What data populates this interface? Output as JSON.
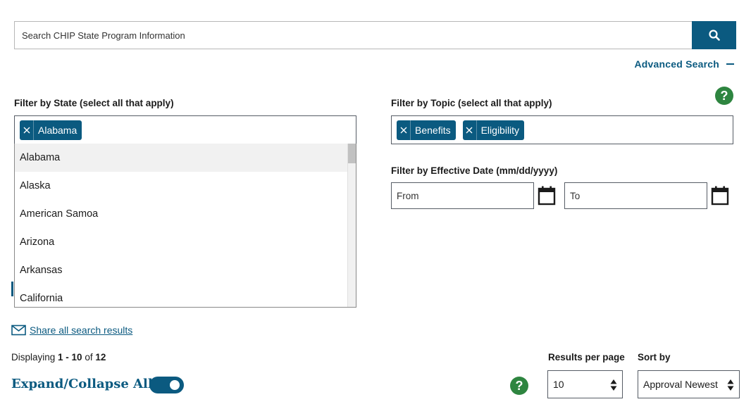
{
  "search": {
    "placeholder": "Search CHIP State Program Information"
  },
  "advanced_search": {
    "label": "Advanced Search"
  },
  "filter_state": {
    "label": "Filter by State (select all that apply)",
    "selected": [
      "Alabama"
    ],
    "options": [
      "Alabama",
      "Alaska",
      "American Samoa",
      "Arizona",
      "Arkansas",
      "California"
    ]
  },
  "filter_topic": {
    "label": "Filter by Topic (select all that apply)",
    "selected": [
      "Benefits",
      "Eligibility"
    ]
  },
  "filter_date": {
    "label": "Filter by Effective Date (mm/dd/yyyy)",
    "from_placeholder": "From",
    "to_placeholder": "To"
  },
  "share": {
    "label": "Share all search results"
  },
  "displaying": {
    "prefix": "Displaying",
    "range": "1 - 10",
    "of": "of",
    "total": "12"
  },
  "expand_collapse": {
    "label": "Expand/Collapse All",
    "on": true
  },
  "results_per_page": {
    "label": "Results per page",
    "value": "10"
  },
  "sort_by": {
    "label": "Sort by",
    "value": "Approval Newest"
  },
  "help_symbol": "?",
  "colors": {
    "primary": "#0b5a80",
    "help": "#2e8540",
    "border": "#565c65"
  },
  "icons": [
    "search-icon",
    "minus-icon",
    "help-icon",
    "close-icon",
    "calendar-icon",
    "mail-icon",
    "sort-arrows-icon"
  ]
}
